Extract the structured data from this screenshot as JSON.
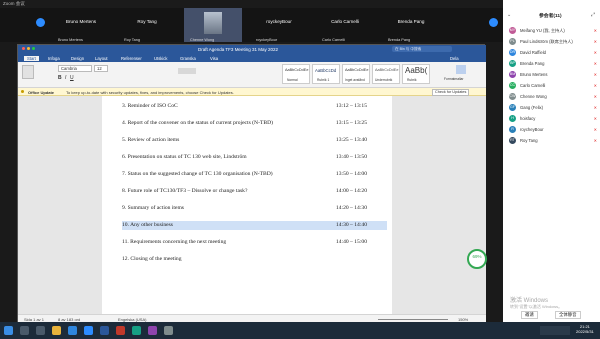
{
  "zoom": {
    "title": "Zoom 会议"
  },
  "gallery": [
    {
      "name": "Bruno Mertens",
      "caption": "Bruno Mertens"
    },
    {
      "name": "Roy Tang",
      "caption": "Roy Tang"
    },
    {
      "name": "",
      "caption": "Chenne Wong"
    },
    {
      "name": "royckeyBour",
      "caption": "royckeyBour"
    },
    {
      "name": "Carlo Carnelli",
      "caption": "Carlo Carnelli"
    },
    {
      "name": "Brenda Pang",
      "caption": "Brenda Pang"
    }
  ],
  "word": {
    "title": "Draft Agenda TF3 Meeting 31 May 2022",
    "search": "在 Bin 与 中搜索",
    "tabs": [
      "Start",
      "Infoga",
      "Design",
      "Layout",
      "Referenser",
      "Utskick",
      "Granska",
      "Visa"
    ],
    "font_name": "Cambria",
    "font_size": "12",
    "styles": [
      "Normal",
      "Rubrik 1",
      "Inget avstånd",
      "Underrubrik",
      "Rubrik"
    ],
    "styles_preview": [
      "AaBbCcDdEe",
      "AaBbCcDd",
      "AaBbCcDdEe",
      "AaBbCcDdEe",
      "AaBb("
    ],
    "formatpane": "Formatmallar",
    "share": "Dela",
    "update_title": "Office Update",
    "update_msg": "To keep up-to-date with security updates, fixes, and improvements, choose Check for Updates.",
    "update_btn": "Check for Updates",
    "agenda": [
      {
        "text": "3.   Reminder of ISO CoC",
        "time": "13:12 – 13:15"
      },
      {
        "text": "4.   Report of the convener on the status of current projects (N-TBD)",
        "time": "13:15 – 13:25"
      },
      {
        "text": "5.   Review of action items",
        "time": "13:25 – 13:40"
      },
      {
        "text": "6.   Presentation on status of TC 130 web site, Lindström",
        "time": "13:40 – 13:50"
      },
      {
        "text": "7.   Status on the suggested change of TC 130 organisation (N-TBD)",
        "time": "13:50 – 14:00"
      },
      {
        "text": "8.   Future role of TC130/TF3 – Dissolve or change task?",
        "time": "14:00 – 14:20"
      },
      {
        "text": "9.   Summary of action items",
        "time": "14:20 – 14:30"
      },
      {
        "text": "10.  Any other business",
        "time": "14:30 – 14:40"
      },
      {
        "text": "11.  Requirements concerning the next meeting",
        "time": "14:40 – 15:00"
      },
      {
        "text": "12.  Closing of the meeting",
        "time": ""
      }
    ],
    "status_page": "Sida 1 av 1",
    "status_words": "8 av 183 ord",
    "status_lang": "Engelska (USA)",
    "zoom": "150%"
  },
  "share_pct": "69%",
  "sidebar": {
    "title": "参会者(11)",
    "participants": [
      {
        "name": "Meifang YU (我, 主持人)",
        "initials": "MY",
        "color": "#c05a96"
      },
      {
        "name": "Paul Lindström (联席主持人)",
        "initials": "PL",
        "color": "#7f8c8d"
      },
      {
        "name": "David Raffield",
        "initials": "DR",
        "color": "#2e86de"
      },
      {
        "name": "Brenda Pang",
        "initials": "BP",
        "color": "#16a085"
      },
      {
        "name": "Bruno Mertens",
        "initials": "BM",
        "color": "#8e44ad"
      },
      {
        "name": "Carlo Carnelli",
        "initials": "CC",
        "color": "#27ae60"
      },
      {
        "name": "Chenne Wong",
        "initials": "CW",
        "color": "#7f8c8d"
      },
      {
        "name": "Gang (Felix)",
        "initials": "GF",
        "color": "#2980b9"
      },
      {
        "name": "hoisfacy",
        "initials": "H",
        "color": "#16a085"
      },
      {
        "name": "roycheyBour",
        "initials": "R",
        "color": "#2980b9"
      },
      {
        "name": "Roy Tang",
        "initials": "RT",
        "color": "#34495e"
      }
    ],
    "invite": "邀请",
    "mute_all": "全体静音"
  },
  "windows_wm": "激活 Windows",
  "windows_wm_sub": "转到\"设置\"以激活 Windows。",
  "clock": {
    "time": "21:21",
    "date": "2022/5/31"
  }
}
